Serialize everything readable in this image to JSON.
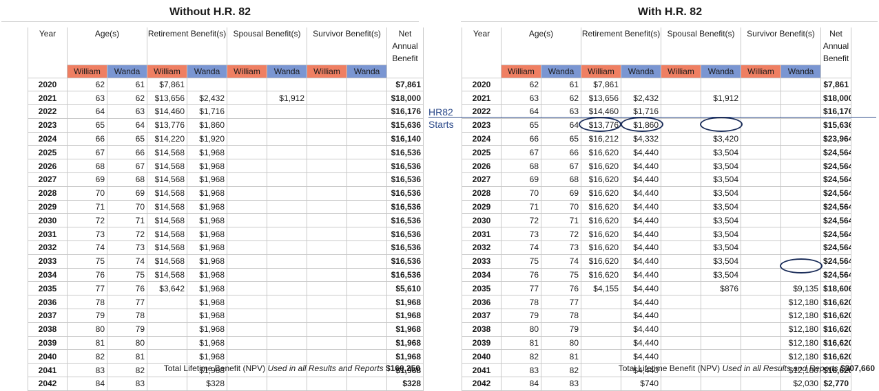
{
  "left": {
    "title": "Without H.R. 82",
    "headers": {
      "year": "Year",
      "ages": "Age(s)",
      "retirement": "Retirement Benefit(s)",
      "spousal": "Spousal Benefit(s)",
      "survivor": "Survivor Benefit(s)",
      "net": "Net Annual Benefit"
    },
    "person_labels": [
      "William",
      "Wanda",
      "William",
      "Wanda",
      "William",
      "Wanda",
      "William",
      "Wanda"
    ],
    "rows": [
      [
        "2020",
        "62",
        "61",
        "$7,861",
        "",
        "",
        "",
        "",
        "",
        "$7,861"
      ],
      [
        "2021",
        "63",
        "62",
        "$13,656",
        "$2,432",
        "",
        "$1,912",
        "",
        "",
        "$18,000"
      ],
      [
        "2022",
        "64",
        "63",
        "$14,460",
        "$1,716",
        "",
        "",
        "",
        "",
        "$16,176"
      ],
      [
        "2023",
        "65",
        "64",
        "$13,776",
        "$1,860",
        "",
        "",
        "",
        "",
        "$15,636"
      ],
      [
        "2024",
        "66",
        "65",
        "$14,220",
        "$1,920",
        "",
        "",
        "",
        "",
        "$16,140"
      ],
      [
        "2025",
        "67",
        "66",
        "$14,568",
        "$1,968",
        "",
        "",
        "",
        "",
        "$16,536"
      ],
      [
        "2026",
        "68",
        "67",
        "$14,568",
        "$1,968",
        "",
        "",
        "",
        "",
        "$16,536"
      ],
      [
        "2027",
        "69",
        "68",
        "$14,568",
        "$1,968",
        "",
        "",
        "",
        "",
        "$16,536"
      ],
      [
        "2028",
        "70",
        "69",
        "$14,568",
        "$1,968",
        "",
        "",
        "",
        "",
        "$16,536"
      ],
      [
        "2029",
        "71",
        "70",
        "$14,568",
        "$1,968",
        "",
        "",
        "",
        "",
        "$16,536"
      ],
      [
        "2030",
        "72",
        "71",
        "$14,568",
        "$1,968",
        "",
        "",
        "",
        "",
        "$16,536"
      ],
      [
        "2031",
        "73",
        "72",
        "$14,568",
        "$1,968",
        "",
        "",
        "",
        "",
        "$16,536"
      ],
      [
        "2032",
        "74",
        "73",
        "$14,568",
        "$1,968",
        "",
        "",
        "",
        "",
        "$16,536"
      ],
      [
        "2033",
        "75",
        "74",
        "$14,568",
        "$1,968",
        "",
        "",
        "",
        "",
        "$16,536"
      ],
      [
        "2034",
        "76",
        "75",
        "$14,568",
        "$1,968",
        "",
        "",
        "",
        "",
        "$16,536"
      ],
      [
        "2035",
        "77",
        "76",
        "$3,642",
        "$1,968",
        "",
        "",
        "",
        "",
        "$5,610"
      ],
      [
        "2036",
        "78",
        "77",
        "",
        "$1,968",
        "",
        "",
        "",
        "",
        "$1,968"
      ],
      [
        "2037",
        "79",
        "78",
        "",
        "$1,968",
        "",
        "",
        "",
        "",
        "$1,968"
      ],
      [
        "2038",
        "80",
        "79",
        "",
        "$1,968",
        "",
        "",
        "",
        "",
        "$1,968"
      ],
      [
        "2039",
        "81",
        "80",
        "",
        "$1,968",
        "",
        "",
        "",
        "",
        "$1,968"
      ],
      [
        "2040",
        "82",
        "81",
        "",
        "$1,968",
        "",
        "",
        "",
        "",
        "$1,968"
      ],
      [
        "2041",
        "83",
        "82",
        "",
        "$1,968",
        "",
        "",
        "",
        "",
        "$1,968"
      ],
      [
        "2042",
        "84",
        "83",
        "",
        "$328",
        "",
        "",
        "",
        "",
        "$328"
      ]
    ],
    "footer": {
      "label": "Total Lifetime Benefit (NPV)",
      "note": "Used in all Results and Reports",
      "total": "$160,250"
    }
  },
  "right": {
    "title": "With H.R. 82",
    "headers": {
      "year": "Year",
      "ages": "Age(s)",
      "retirement": "Retirement Benefit(s)",
      "spousal": "Spousal Benefit(s)",
      "survivor": "Survivor Benefit(s)",
      "net": "Net Annual Benefit"
    },
    "person_labels": [
      "William",
      "Wanda",
      "William",
      "Wanda",
      "William",
      "Wanda",
      "William",
      "Wanda"
    ],
    "rows": [
      [
        "2020",
        "62",
        "61",
        "$7,861",
        "",
        "",
        "",
        "",
        "",
        "$7,861"
      ],
      [
        "2021",
        "63",
        "62",
        "$13,656",
        "$2,432",
        "",
        "$1,912",
        "",
        "",
        "$18,000"
      ],
      [
        "2022",
        "64",
        "63",
        "$14,460",
        "$1,716",
        "",
        "",
        "",
        "",
        "$16,176"
      ],
      [
        "2023",
        "65",
        "64",
        "$13,776",
        "$1,860",
        "",
        "",
        "",
        "",
        "$15,636"
      ],
      [
        "2024",
        "66",
        "65",
        "$16,212",
        "$4,332",
        "",
        "$3,420",
        "",
        "",
        "$23,964"
      ],
      [
        "2025",
        "67",
        "66",
        "$16,620",
        "$4,440",
        "",
        "$3,504",
        "",
        "",
        "$24,564"
      ],
      [
        "2026",
        "68",
        "67",
        "$16,620",
        "$4,440",
        "",
        "$3,504",
        "",
        "",
        "$24,564"
      ],
      [
        "2027",
        "69",
        "68",
        "$16,620",
        "$4,440",
        "",
        "$3,504",
        "",
        "",
        "$24,564"
      ],
      [
        "2028",
        "70",
        "69",
        "$16,620",
        "$4,440",
        "",
        "$3,504",
        "",
        "",
        "$24,564"
      ],
      [
        "2029",
        "71",
        "70",
        "$16,620",
        "$4,440",
        "",
        "$3,504",
        "",
        "",
        "$24,564"
      ],
      [
        "2030",
        "72",
        "71",
        "$16,620",
        "$4,440",
        "",
        "$3,504",
        "",
        "",
        "$24,564"
      ],
      [
        "2031",
        "73",
        "72",
        "$16,620",
        "$4,440",
        "",
        "$3,504",
        "",
        "",
        "$24,564"
      ],
      [
        "2032",
        "74",
        "73",
        "$16,620",
        "$4,440",
        "",
        "$3,504",
        "",
        "",
        "$24,564"
      ],
      [
        "2033",
        "75",
        "74",
        "$16,620",
        "$4,440",
        "",
        "$3,504",
        "",
        "",
        "$24,564"
      ],
      [
        "2034",
        "76",
        "75",
        "$16,620",
        "$4,440",
        "",
        "$3,504",
        "",
        "",
        "$24,564"
      ],
      [
        "2035",
        "77",
        "76",
        "$4,155",
        "$4,440",
        "",
        "$876",
        "",
        "$9,135",
        "$18,606"
      ],
      [
        "2036",
        "78",
        "77",
        "",
        "$4,440",
        "",
        "",
        "",
        "$12,180",
        "$16,620"
      ],
      [
        "2037",
        "79",
        "78",
        "",
        "$4,440",
        "",
        "",
        "",
        "$12,180",
        "$16,620"
      ],
      [
        "2038",
        "80",
        "79",
        "",
        "$4,440",
        "",
        "",
        "",
        "$12,180",
        "$16,620"
      ],
      [
        "2039",
        "81",
        "80",
        "",
        "$4,440",
        "",
        "",
        "",
        "$12,180",
        "$16,620"
      ],
      [
        "2040",
        "82",
        "81",
        "",
        "$4,440",
        "",
        "",
        "",
        "$12,180",
        "$16,620"
      ],
      [
        "2041",
        "83",
        "82",
        "",
        "$4,440",
        "",
        "",
        "",
        "$12,180",
        "$16,620"
      ],
      [
        "2042",
        "84",
        "83",
        "",
        "$740",
        "",
        "",
        "",
        "$2,030",
        "$2,770"
      ]
    ],
    "footer": {
      "label": "Total Lifetime Benefit (NPV)",
      "note": "Used in all Results and Reports",
      "total": "$307,660"
    }
  },
  "annotation": {
    "line1": "HR82",
    "line2": "Starts"
  },
  "colors": {
    "william": "#ef7f62",
    "wanda": "#7a96d2",
    "annotation": "#2c4a8a"
  }
}
